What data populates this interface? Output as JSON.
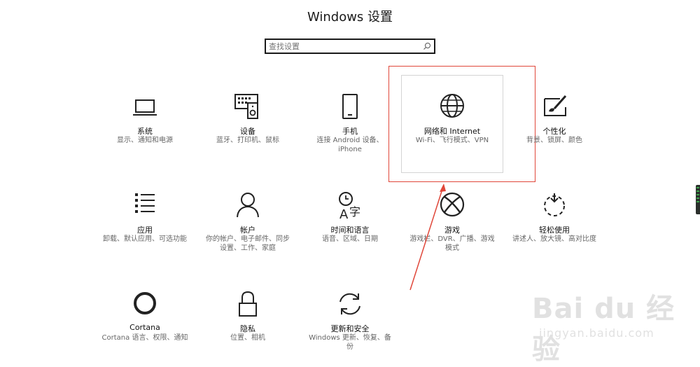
{
  "header": {
    "title": "Windows 设置"
  },
  "search": {
    "placeholder": "查找设置",
    "icon": "search-icon"
  },
  "tiles": [
    {
      "id": "system",
      "icon": "laptop-icon",
      "name": "系统",
      "desc": "显示、通知和电源"
    },
    {
      "id": "devices",
      "icon": "keyboard-speaker-icon",
      "name": "设备",
      "desc": "蓝牙、打印机、鼠标"
    },
    {
      "id": "phone",
      "icon": "phone-icon",
      "name": "手机",
      "desc": "连接 Android 设备、iPhone"
    },
    {
      "id": "network",
      "icon": "globe-icon",
      "name": "网络和 Internet",
      "desc": "Wi-Fi、飞行模式、VPN"
    },
    {
      "id": "personalization",
      "icon": "paint-brush-icon",
      "name": "个性化",
      "desc": "背景、锁屏、颜色"
    },
    {
      "id": "apps",
      "icon": "app-list-icon",
      "name": "应用",
      "desc": "卸载、默认应用、可选功能"
    },
    {
      "id": "accounts",
      "icon": "person-icon",
      "name": "帐户",
      "desc": "你的帐户、电子邮件、同步设置、工作、家庭"
    },
    {
      "id": "time-language",
      "icon": "time-language-icon",
      "name": "时间和语言",
      "desc": "语音、区域、日期"
    },
    {
      "id": "gaming",
      "icon": "xbox-icon",
      "name": "游戏",
      "desc": "游戏栏、DVR、广播、游戏模式"
    },
    {
      "id": "ease-of-access",
      "icon": "ease-of-access-icon",
      "name": "轻松使用",
      "desc": "讲述人、放大镜、高对比度"
    },
    {
      "id": "cortana",
      "icon": "cortana-ring-icon",
      "name": "Cortana",
      "desc": "Cortana 语言、权限、通知"
    },
    {
      "id": "privacy",
      "icon": "lock-icon",
      "name": "隐私",
      "desc": "位置、相机"
    },
    {
      "id": "update-security",
      "icon": "sync-icon",
      "name": "更新和安全",
      "desc": "Windows 更新、恢复、备份"
    }
  ],
  "watermark": {
    "brand": "Bai du 经验",
    "url": "jingyan.baidu.com"
  },
  "colors": {
    "annotation": "#e0473a",
    "text": "#1f1f1f",
    "secondary": "#666666"
  }
}
